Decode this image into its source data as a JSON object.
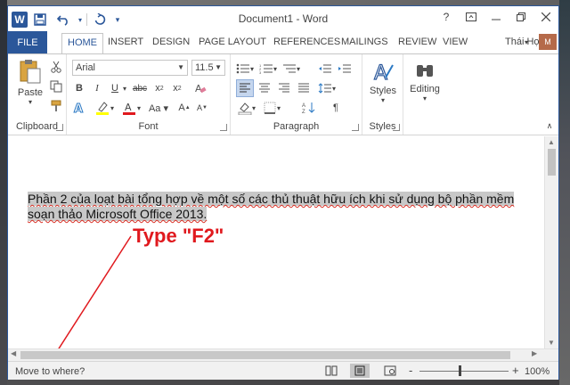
{
  "window": {
    "title": "Document1 - Word",
    "help": "?",
    "accent_color": "#2b579a"
  },
  "qat": {
    "app_icon_letter": "W"
  },
  "tabs": [
    {
      "label": "FILE"
    },
    {
      "label": "HOME"
    },
    {
      "label": "INSERT"
    },
    {
      "label": "DESIGN"
    },
    {
      "label": "PAGE LAYOUT"
    },
    {
      "label": "REFERENCES"
    },
    {
      "label": "MAILINGS"
    },
    {
      "label": "REVIEW"
    },
    {
      "label": "VIEW"
    }
  ],
  "user": {
    "name": "Thái Học",
    "avatar_text": "M"
  },
  "ribbon": {
    "clipboard": {
      "paste_label": "Paste",
      "group_label": "Clipboard"
    },
    "font": {
      "family": "Arial",
      "size": "11.5",
      "group_label": "Font"
    },
    "paragraph": {
      "group_label": "Paragraph"
    },
    "styles": {
      "styles_label": "Styles",
      "group_label": "Styles"
    },
    "editing": {
      "editing_label": "Editing"
    }
  },
  "document": {
    "body_text": "Phần 2 của loạt bài tổng hợp về một số các thủ thuật hữu ích khi sử dụng bộ phần mềm soạn thảo Microsoft Office 2013.",
    "annotation": "Type \"F2\"",
    "annotation_color": "#e0191e"
  },
  "status": {
    "prompt": "Move to where?",
    "zoom": "100%",
    "zoom_minus": "-",
    "zoom_plus": "+"
  }
}
